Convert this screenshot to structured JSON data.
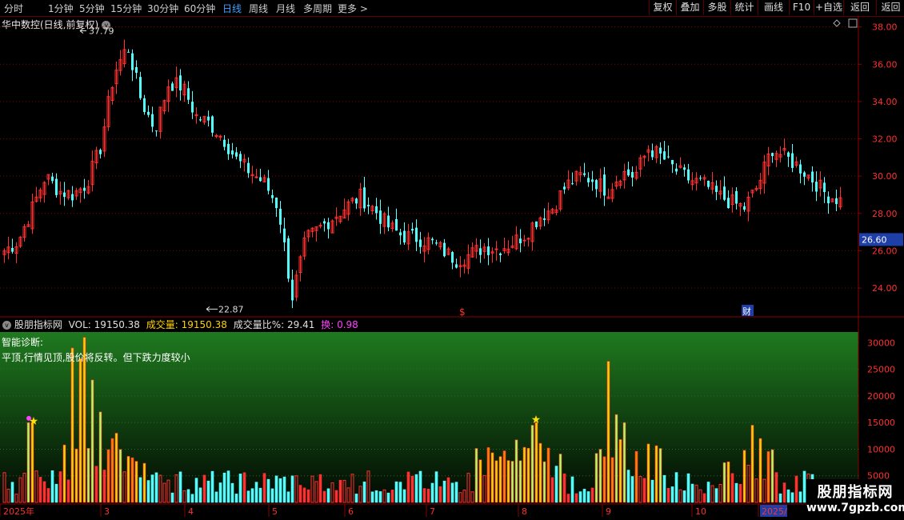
{
  "toolbar": {
    "periods": [
      "分时",
      "1分钟",
      "5分钟",
      "15分钟",
      "30分钟",
      "60分钟",
      "日线",
      "周线",
      "月线",
      "多周期",
      "更多 >"
    ],
    "active": "日线",
    "right_buttons": [
      "复权",
      "叠加",
      "多股",
      "统计",
      "画线",
      "F10",
      "+自选",
      "返回"
    ]
  },
  "chart_header": {
    "title": "华中数控(日线,前复权)",
    "collapse_glyph": "v",
    "icons": [
      "diamond-icon",
      "window-icon"
    ]
  },
  "price_axis": {
    "ticks": [
      "38.00",
      "36.00",
      "34.00",
      "32.00",
      "30.00",
      "28.00",
      "26.00",
      "24.00"
    ],
    "current_price": "26.60"
  },
  "annotations": {
    "high_label": "37.79",
    "low_label": "22.87",
    "marker_dollar": "$",
    "marker_finance": "财"
  },
  "indicator": {
    "name": "股朋指标网",
    "vol_label": "VOL:",
    "vol_value": "19150.38",
    "turnover_label": "成交量:",
    "turnover_value": "19150.38",
    "ratio_label": "成交量比%:",
    "ratio_value": "29.41",
    "huan_label": "换:",
    "huan_value": "0.98",
    "diag_title": "智能诊断:",
    "diag_text": "平顶,行情见顶,股价将反转。但下跌力度较小",
    "axis_ticks": [
      "30000",
      "25000",
      "20000",
      "15000",
      "10000",
      "5000"
    ]
  },
  "time_axis": {
    "labels": [
      "2025年",
      "3",
      "4",
      "5",
      "6",
      "7",
      "8",
      "9",
      "10",
      "2025/"
    ]
  },
  "brand": {
    "name": "股朋指标网",
    "url": "www.7gpzb.com"
  },
  "colors": {
    "up": "#ff3030",
    "down": "#54ffff",
    "grid": "#8a0000",
    "active_tab": "#3fa0ff",
    "price_tag": "#1e3ea8",
    "vol_yellow": "#ffd200",
    "vol_green": "#a8ff60",
    "vol_orange": "#ff8000",
    "magenta": "#ff40ff"
  },
  "chart_data": {
    "type": "candlestick",
    "price_ylim": [
      22.5,
      38.5
    ],
    "volume_ylim": [
      0,
      32000
    ],
    "price_path": [
      26.0,
      26.5,
      28.2,
      30.0,
      29.2,
      29.0,
      29.6,
      31.5,
      35.5,
      37.0,
      34.0,
      32.5,
      35.0,
      34.8,
      33.2,
      32.8,
      32.0,
      30.8,
      30.2,
      29.6,
      28.3,
      23.5,
      26.6,
      27.2,
      27.8,
      28.4,
      28.9,
      28.2,
      27.3,
      26.8,
      26.7,
      26.5,
      26.0,
      25.5,
      25.8,
      26.2,
      26.1,
      26.4,
      26.9,
      27.8,
      28.3,
      29.5,
      30.0,
      29.8,
      29.2,
      30.2,
      30.0,
      31.5,
      31.0,
      30.3,
      29.8,
      29.6,
      29.0,
      28.6,
      28.3,
      29.5,
      31.5,
      31.0,
      30.5,
      29.8,
      29.0,
      28.7
    ]
  }
}
